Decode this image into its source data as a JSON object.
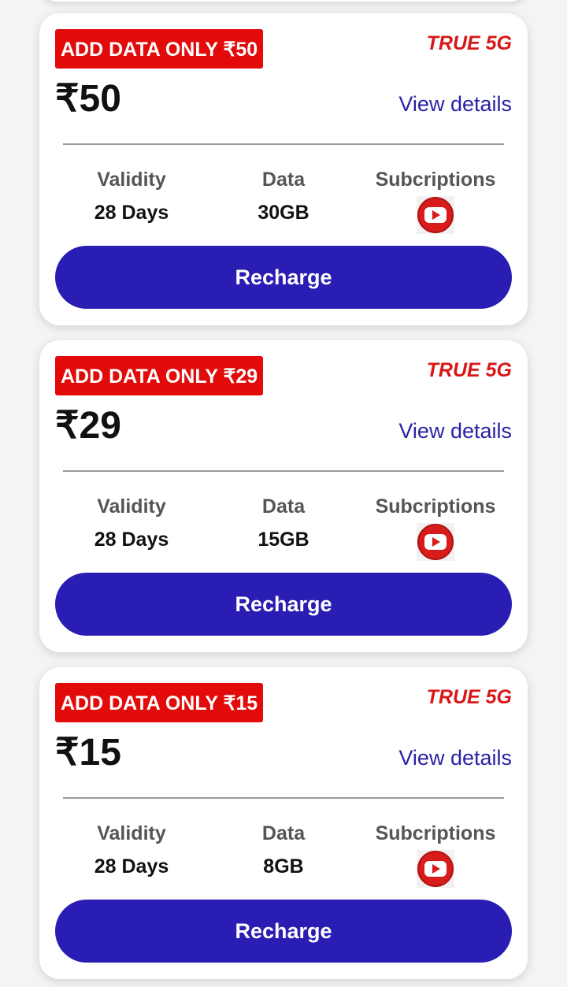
{
  "plans": [
    {
      "badge": "ADD DATA ONLY ₹50",
      "network_tag": "TRUE 5G",
      "price": "₹50",
      "details_link": "View details",
      "validity_label": "Validity",
      "validity_value": "28 Days",
      "data_label": "Data",
      "data_value": "30GB",
      "subscriptions_label": "Subcriptions",
      "subscription_icon": "youtube-icon",
      "button_label": "Recharge"
    },
    {
      "badge": "ADD DATA ONLY ₹29",
      "network_tag": "TRUE 5G",
      "price": "₹29",
      "details_link": "View details",
      "validity_label": "Validity",
      "validity_value": "28 Days",
      "data_label": "Data",
      "data_value": "15GB",
      "subscriptions_label": "Subcriptions",
      "subscription_icon": "youtube-icon",
      "button_label": "Recharge"
    },
    {
      "badge": "ADD DATA ONLY ₹15",
      "network_tag": "TRUE 5G",
      "price": "₹15",
      "details_link": "View details",
      "validity_label": "Validity",
      "validity_value": "28 Days",
      "data_label": "Data",
      "data_value": "8GB",
      "subscriptions_label": "Subcriptions",
      "subscription_icon": "youtube-icon",
      "button_label": "Recharge"
    }
  ],
  "colors": {
    "badge_bg": "#e30a0a",
    "network_tag": "#d81818",
    "link": "#2a22a6",
    "button_bg": "#2a1db3",
    "youtube_red": "#d81b1b"
  }
}
